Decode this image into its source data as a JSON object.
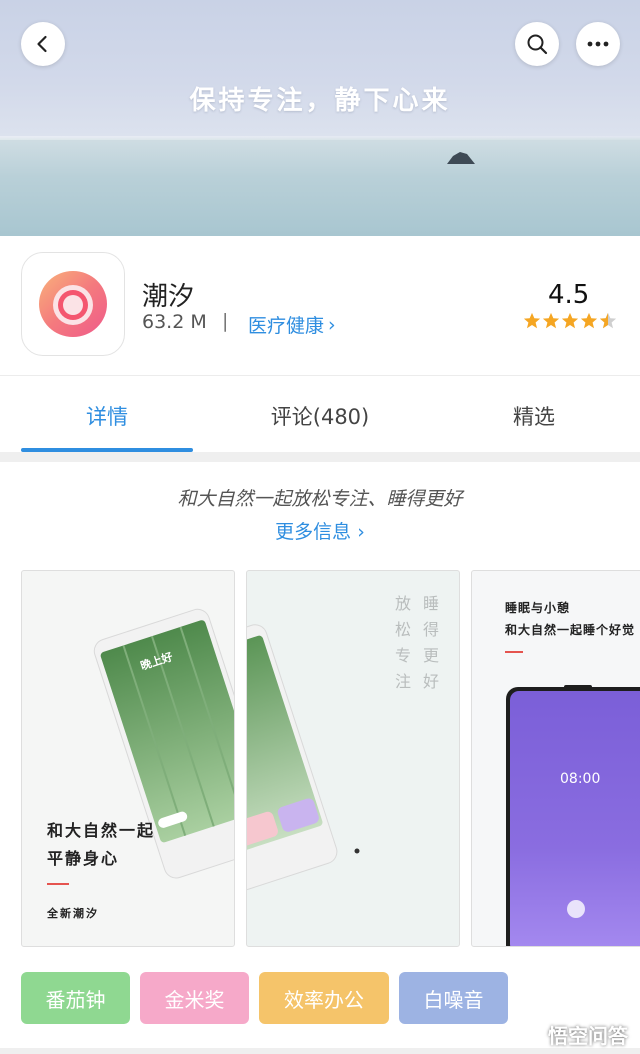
{
  "hero": {
    "title": "保持专注，静下心来"
  },
  "app": {
    "name": "潮汐",
    "size": "63.2 M",
    "separator": "|",
    "category": "医疗健康",
    "category_chevron": "›",
    "rating": "4.5",
    "stars": 4.5
  },
  "tabs": [
    {
      "label": "详情",
      "active": true
    },
    {
      "label": "评论(480)",
      "active": false
    },
    {
      "label": "精选",
      "active": false
    }
  ],
  "description": {
    "text": "和大自然一起放松专注、睡得更好",
    "more_link": "更多信息 ›"
  },
  "screenshots": {
    "s1": {
      "greeting": "晚上好",
      "headline_1": "和大自然一起",
      "headline_2": "平静身心",
      "footer": "全新潮汐"
    },
    "s2": {
      "col1": "睡得更好",
      "col2": "放松专注"
    },
    "s3": {
      "title_1": "睡眠与小憩",
      "title_2": "和大自然一起睡个好觉",
      "time": "08:00"
    }
  },
  "tags": [
    {
      "label": "番茄钟",
      "color": "#8fd891"
    },
    {
      "label": "金米奖",
      "color": "#f6a9c9"
    },
    {
      "label": "效率办公",
      "color": "#f5c46a"
    },
    {
      "label": "白噪音",
      "color": "#9db3e3"
    }
  ],
  "watermark": "悟空问答",
  "colors": {
    "accent": "#2f8ee0",
    "star": "#f5a623"
  }
}
